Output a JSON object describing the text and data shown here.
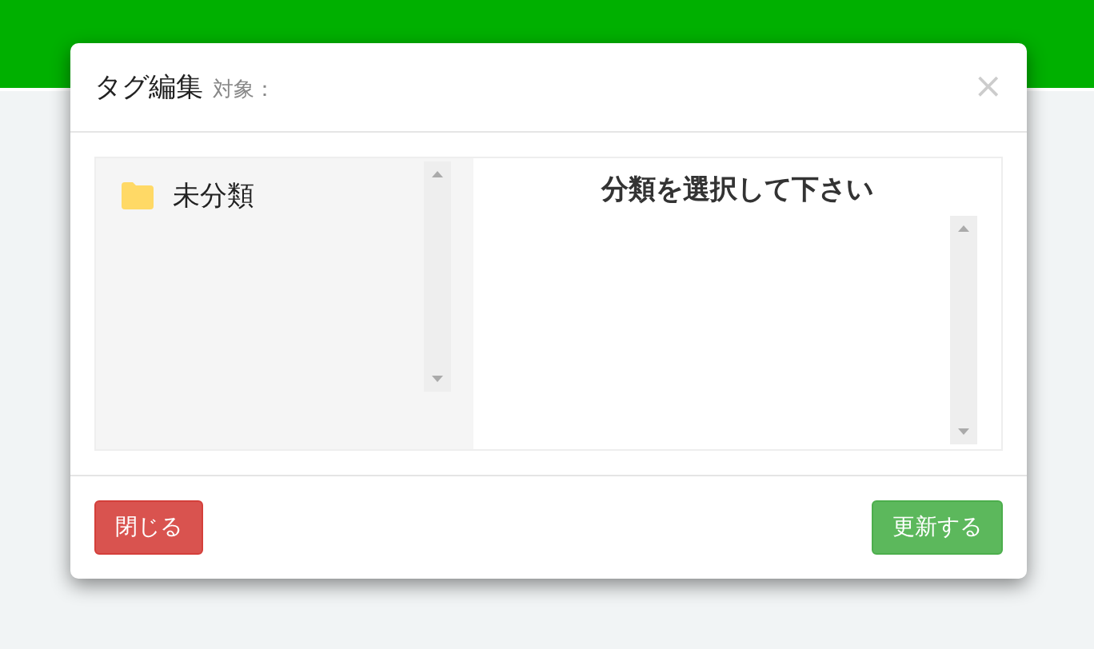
{
  "dialog": {
    "title": "タグ編集",
    "subtitle": "対象：",
    "close_glyph": "×"
  },
  "categories": [
    {
      "label": "未分類",
      "selected": false
    }
  ],
  "tag_panel": {
    "heading": "分類を選択して下さい"
  },
  "buttons": [
    {
      "label": "閉じる",
      "kind": "danger"
    },
    {
      "label": "更新する",
      "kind": "success"
    }
  ]
}
